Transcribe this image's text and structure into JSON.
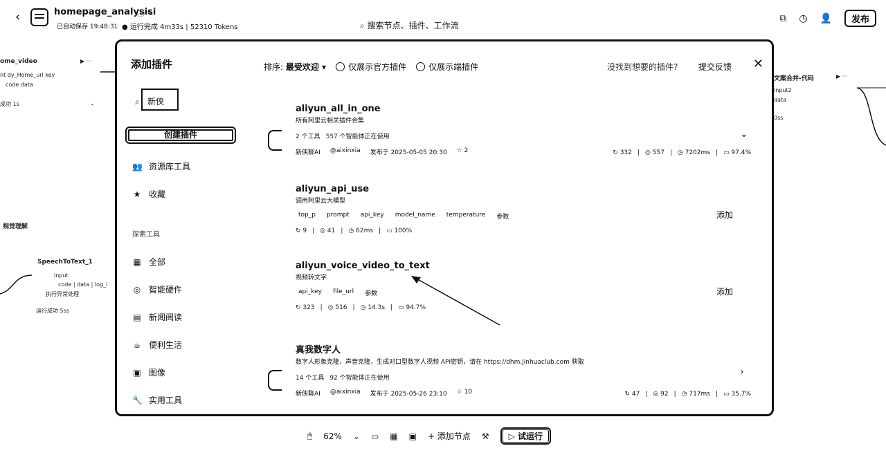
{
  "header": {
    "back": "‹",
    "title": "homepage_analysisi",
    "title_icons": "ⓘ ✎",
    "save_status": "已自动保存 19:48:31",
    "run_status": "运行完成 4m33s | 52310 Tokens",
    "search_placeholder": "搜索节点、插件、工作流",
    "publish": "发布"
  },
  "canvas": {
    "left_node_title": "ome_video",
    "left_node_params": "nt  dy_Home_url  key",
    "left_node_outputs": "code  data",
    "left_node_status": "成功  1s",
    "left_node2": "视觉理解",
    "stt_node": "SpeechToText_1",
    "stt_input": "input",
    "stt_outputs": "code  |  data  |  log_i",
    "stt_note": "执行异常处理",
    "stt_status": "运行成功  5ss",
    "right_node_title": "文案合并-代码",
    "right_input": "input2",
    "right_data": "data",
    "right_ms": "0ss"
  },
  "modal": {
    "title": "添加插件",
    "close": "✕",
    "search_value": "新侠",
    "create_button": "创建插件",
    "sidebar_top": [
      {
        "icon": "users-icon",
        "glyph": "👥",
        "label": "资源库工具"
      },
      {
        "icon": "star-icon",
        "glyph": "★",
        "label": "收藏"
      }
    ],
    "explore_label": "探索工具",
    "sidebar_categories": [
      {
        "icon": "grid-icon",
        "glyph": "▦",
        "label": "全部"
      },
      {
        "icon": "hardware-icon",
        "glyph": "◎",
        "label": "智能硬件"
      },
      {
        "icon": "news-icon",
        "glyph": "▤",
        "label": "新闻阅读"
      },
      {
        "icon": "life-icon",
        "glyph": "☕",
        "label": "便利生活"
      },
      {
        "icon": "image-icon",
        "glyph": "▣",
        "label": "图像"
      },
      {
        "icon": "wrench-icon",
        "glyph": "🔧",
        "label": "实用工具"
      }
    ],
    "sort_label": "排序:",
    "sort_value": "最受欢迎 ▾",
    "filter_official": "仅展示官方插件",
    "filter_edge": "仅展示端插件",
    "not_found": "没找到想要的插件?",
    "feedback": "提交反馈",
    "add_label": "添加",
    "plugins": [
      {
        "name": "aliyun_all_in_one",
        "desc": "所有阿里云相关插件合集",
        "tools": "2 个工具",
        "agents": "557 个智能体正在使用",
        "author": "新侠聊AI",
        "handle": "@aixinxia",
        "published": "发布于 2025-05-05 20:30",
        "stars": "2",
        "runs": "332",
        "users": "557",
        "latency": "7202ms",
        "success": "97.4%"
      },
      {
        "name": "aliyun_api_use",
        "desc": "调用阿里云大模型",
        "params": [
          "top_p",
          "prompt",
          "api_key",
          "model_name",
          "temperature",
          "参数"
        ],
        "runs": "9",
        "users": "41",
        "latency": "62ms",
        "success": "100%"
      },
      {
        "name": "aliyun_voice_video_to_text",
        "desc": "视频转文字",
        "params": [
          "api_key",
          "file_url",
          "参数"
        ],
        "runs": "323",
        "users": "516",
        "latency": "14.3s",
        "success": "94.7%"
      },
      {
        "name": "真我数字人",
        "desc": "数字人形象克隆，声音克隆，生成对口型数字人视频 API密钥，请在 https://dhm.jinhuaclub.com 获取",
        "tools": "14 个工具",
        "agents": "92 个智能体正在使用",
        "author": "新侠聊AI",
        "handle": "@aixinxia",
        "published": "发布于 2025-05-26 23:10",
        "stars": "10",
        "runs": "47",
        "users": "92",
        "latency": "717ms",
        "success": "35.7%"
      }
    ]
  },
  "toolbar": {
    "zoom": "62%",
    "add_node": "添加节点",
    "run": "试运行"
  }
}
